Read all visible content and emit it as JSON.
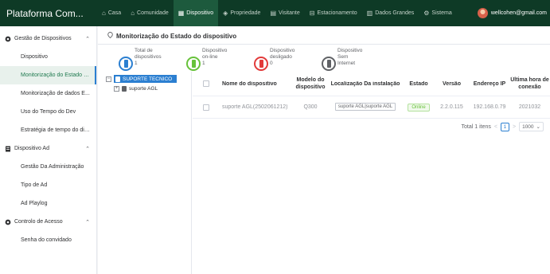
{
  "app": {
    "title": "Plataforma Com..."
  },
  "nav": [
    {
      "label": "Casa",
      "icon": "home-icon"
    },
    {
      "label": "Comunidade",
      "icon": "community-icon"
    },
    {
      "label": "Dispositivo",
      "icon": "device-icon",
      "active": true
    },
    {
      "label": "Propriedade",
      "icon": "property-icon"
    },
    {
      "label": "Visitante",
      "icon": "visitor-icon"
    },
    {
      "label": "Estacionamento",
      "icon": "parking-icon"
    },
    {
      "label": "Dados Grandes",
      "icon": "chart-icon"
    },
    {
      "label": "Sistema",
      "icon": "gear-icon"
    }
  ],
  "user": {
    "email": "wellcohen@gmail.com"
  },
  "sidebar": {
    "groups": [
      {
        "label": "Gestão de Dispositivos",
        "icon": "settings-icon",
        "items": [
          {
            "label": "Dispositivo"
          },
          {
            "label": "Monitorização do Estado d...",
            "active": true
          },
          {
            "label": "Monitorização de dados E..."
          },
          {
            "label": "Uso do Tempo do Dev"
          },
          {
            "label": "Estratégia de tempo do dis..."
          }
        ]
      },
      {
        "label": "Dispositivo Ad",
        "icon": "ad-icon",
        "items": [
          {
            "label": "Gestão Da Administração"
          },
          {
            "label": "Tipo de Ad"
          },
          {
            "label": "Ad Playlog"
          }
        ]
      },
      {
        "label": "Controlo de Acesso",
        "icon": "access-icon",
        "items": [
          {
            "label": "Senha do convidado"
          }
        ]
      }
    ]
  },
  "page": {
    "title": "Monitorização do Estado do dispositivo"
  },
  "stats": [
    {
      "line1": "Total de",
      "line2": "dispositivos",
      "value": "1",
      "color": "#2b7fd1"
    },
    {
      "line1": "Dispositivo",
      "line2": "on-line",
      "value": "1",
      "color": "#67c23a"
    },
    {
      "line1": "Dispositivo",
      "line2": "desligado",
      "value": "0",
      "color": "#e23a3a"
    },
    {
      "line1": "Dispositivo",
      "line2": "Sem",
      "value": "Internet",
      "color": "#606266"
    }
  ],
  "tree": [
    {
      "label": "SUPORTE TECNICO",
      "expand": "−",
      "selected": true
    },
    {
      "label": "suporte AGL",
      "expand": "+"
    }
  ],
  "table": {
    "headers": {
      "name": "Nome do dispositivo",
      "model": "Modelo do dispositivo",
      "location": "Localização Da instalação",
      "state": "Estado",
      "version": "Versão",
      "ip": "Endereço IP",
      "last": "Última hora de conexão"
    },
    "rows": [
      {
        "name": "suporte AGL(2502061212)",
        "model": "Q300",
        "location": "suporte AGL|suporte AGL",
        "state": "Online",
        "version": "2.2.0.115",
        "ip": "192.168.0.79",
        "last": "2021032"
      }
    ]
  },
  "pager": {
    "total": "Total 1 itens",
    "page": "1",
    "size": "1000"
  },
  "colors": {
    "topbar": "#0e3a26",
    "accent": "#2b7fd1",
    "online": "#67c23a"
  }
}
